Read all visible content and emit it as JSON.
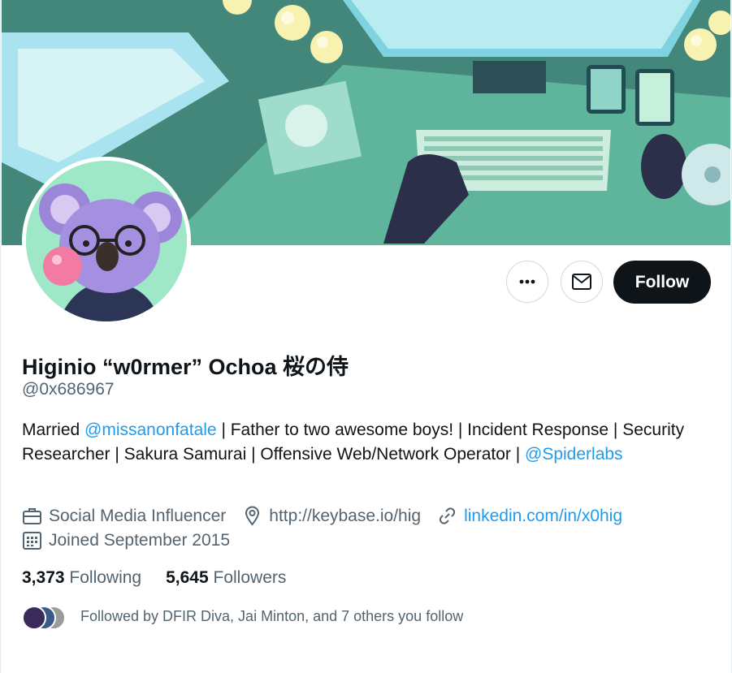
{
  "profile": {
    "name": "Higinio “w0rmer” Ochoa 桜の侍",
    "handle": "@0x686967",
    "bio": {
      "part1": "Married ",
      "mention1": "@missanonfatale",
      "part2": " | Father to two awesome boys! | Incident Response | Security Researcher | Sakura Samurai | Offensive Web/Network Operator | ",
      "mention2": "@Spiderlabs"
    },
    "category": "Social Media Influencer",
    "location": "http://keybase.io/hig",
    "website": "linkedin.com/in/x0hig",
    "joined": "Joined September 2015"
  },
  "actions": {
    "follow_label": "Follow",
    "more_icon": "more-icon",
    "message_icon": "envelope-icon"
  },
  "stats": {
    "following_count": "3,373",
    "following_label": " Following",
    "followers_count": "5,645",
    "followers_label": " Followers"
  },
  "followed_by": "Followed by DFIR Diva, Jai Minton, and 7 others you follow",
  "colors": {
    "link": "#1d9bf0",
    "follow_button": "#0f1419",
    "secondary_text": "#536471"
  }
}
